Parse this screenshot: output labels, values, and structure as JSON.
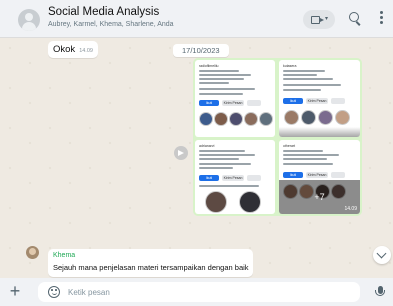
{
  "header": {
    "title": "Social Media Analysis",
    "participants": "Aubrey, Karmel, Khema, Sharlene, Anda",
    "icons": [
      "avatar-placeholder",
      "video-call-icon",
      "search-icon",
      "menu-icon"
    ]
  },
  "messages": {
    "ok": {
      "text": "Okok",
      "time": "14.09"
    },
    "date_separator": "17/10/2023",
    "album": {
      "extra_count_label": "+7",
      "time": "14.09",
      "tiles": [
        {
          "profile": "radioflimelilu",
          "follow_label": "Ikuti",
          "message_label": "Kirim Pesan"
        },
        {
          "profile": "kutasera",
          "follow_label": "Ikuti",
          "message_label": "Kirim Pesan"
        },
        {
          "profile": "adrianarvi",
          "follow_label": "Ikuti",
          "message_label": "Kirim Pesan"
        },
        {
          "profile": "otherart",
          "follow_label": "Ikuti",
          "message_label": "Kirim Pesan"
        }
      ]
    },
    "khema": {
      "sender": "Khema",
      "text": "Sejauh mana penjelasan materi tersampaikan dengan baik"
    }
  },
  "composer": {
    "placeholder": "Ketik pesan",
    "icons": [
      "plus-icon",
      "emoji-icon",
      "microphone-icon"
    ]
  },
  "colors": {
    "header_bg": "#f0f2f5",
    "chat_bg": "#efeae2",
    "outgoing_bubble": "#d9fdd3",
    "sender_name": "#1fa855",
    "instagram_button": "#1d6fe8"
  }
}
